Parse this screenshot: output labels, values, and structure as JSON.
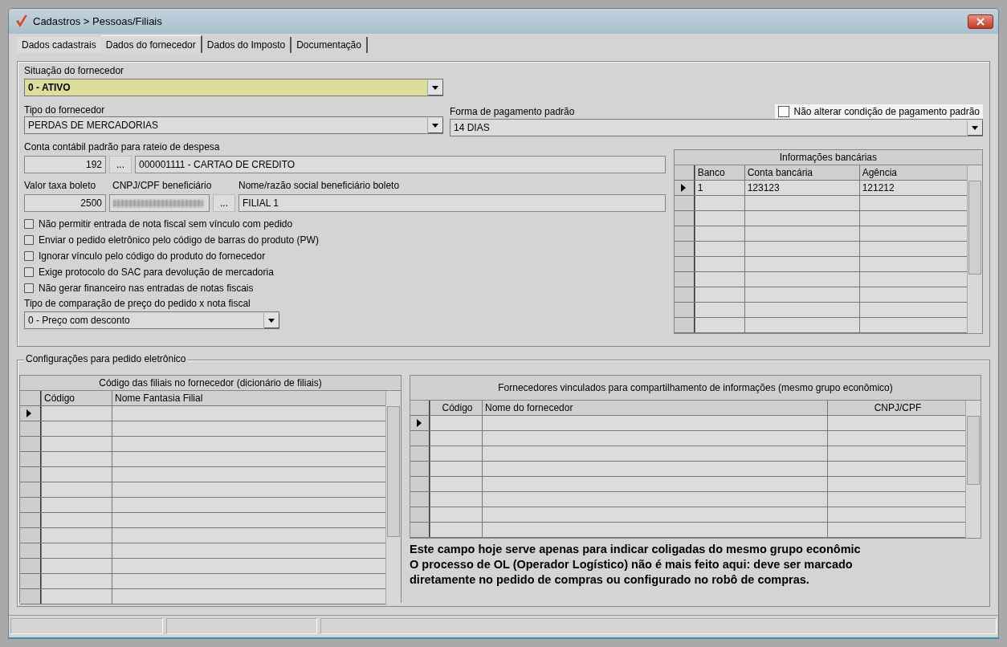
{
  "window": {
    "title": "Cadastros > Pessoas/Filiais"
  },
  "tabs": [
    {
      "label": "Dados cadastrais",
      "selected": false
    },
    {
      "label": "Dados do fornecedor",
      "selected": true
    },
    {
      "label": "Dados do Imposto",
      "selected": false
    },
    {
      "label": "Documentação",
      "selected": false
    }
  ],
  "situacao": {
    "label": "Situação do fornecedor",
    "value": "0 - ATIVO"
  },
  "tipo": {
    "label": "Tipo do fornecedor",
    "value": "PERDAS DE MERCADORIAS"
  },
  "forma_pagamento": {
    "label": "Forma de pagamento padrão",
    "value": "14 DIAS"
  },
  "nao_alterar": {
    "label": "Não alterar condição de pagamento padrão",
    "checked": false
  },
  "conta_contabil": {
    "label": "Conta contábil padrão para rateio de despesa",
    "code": "192",
    "button": "...",
    "description": "000001111 - CARTAO DE CREDITO"
  },
  "valor_taxa": {
    "label": "Valor taxa boleto",
    "value": "2500"
  },
  "cnpj_beneficiario": {
    "label": "CNPJ/CPF beneficiário",
    "button": "..."
  },
  "nome_beneficiario": {
    "label": "Nome/razão social beneficiário boleto",
    "value": "FILIAL 1"
  },
  "options": [
    {
      "label": "Não permitir entrada de nota fiscal sem vínculo com pedido",
      "checked": false
    },
    {
      "label": "Enviar o pedido eletrônico pelo código de barras do produto (PW)",
      "checked": false
    },
    {
      "label": "Ignorar vínculo pelo código do produto do fornecedor",
      "checked": false
    },
    {
      "label": "Exige protocolo do SAC para devolução de mercadoria",
      "checked": false
    },
    {
      "label": "Não gerar financeiro nas entradas de notas fiscais",
      "checked": false
    }
  ],
  "comparacao": {
    "label": "Tipo de comparação de preço do pedido x nota fiscal",
    "value": "0 - Preço com desconto"
  },
  "bank_info": {
    "title": "Informações bancárias",
    "columns": [
      "Banco",
      "Conta bancária",
      "Agência"
    ],
    "rows": [
      {
        "cells": [
          "1",
          "123123",
          "121212"
        ],
        "selected": true
      }
    ]
  },
  "pedido_eletronico": {
    "title": "Configurações para pedido eletrônico",
    "branch_codes": {
      "title": "Código das filiais no fornecedor (dicionário de filiais)",
      "columns": [
        "Código",
        "Nome Fantasia Filial"
      ],
      "rows": [
        {
          "selected": true
        }
      ]
    },
    "linked_suppliers": {
      "title": "Fornecedores vinculados para compartilhamento de informações (mesmo grupo econômico)",
      "columns": [
        "Código",
        "Nome do fornecedor",
        "CNPJ/CPF"
      ],
      "rows": [
        {
          "selected": true
        }
      ]
    },
    "note": [
      "Este campo hoje serve apenas para indicar coligadas do mesmo grupo econômic",
      "O processo de OL (Operador Logístico) não é mais feito aqui: deve ser marcado",
      "diretamente no pedido de compras ou configurado no robô de compras."
    ]
  }
}
